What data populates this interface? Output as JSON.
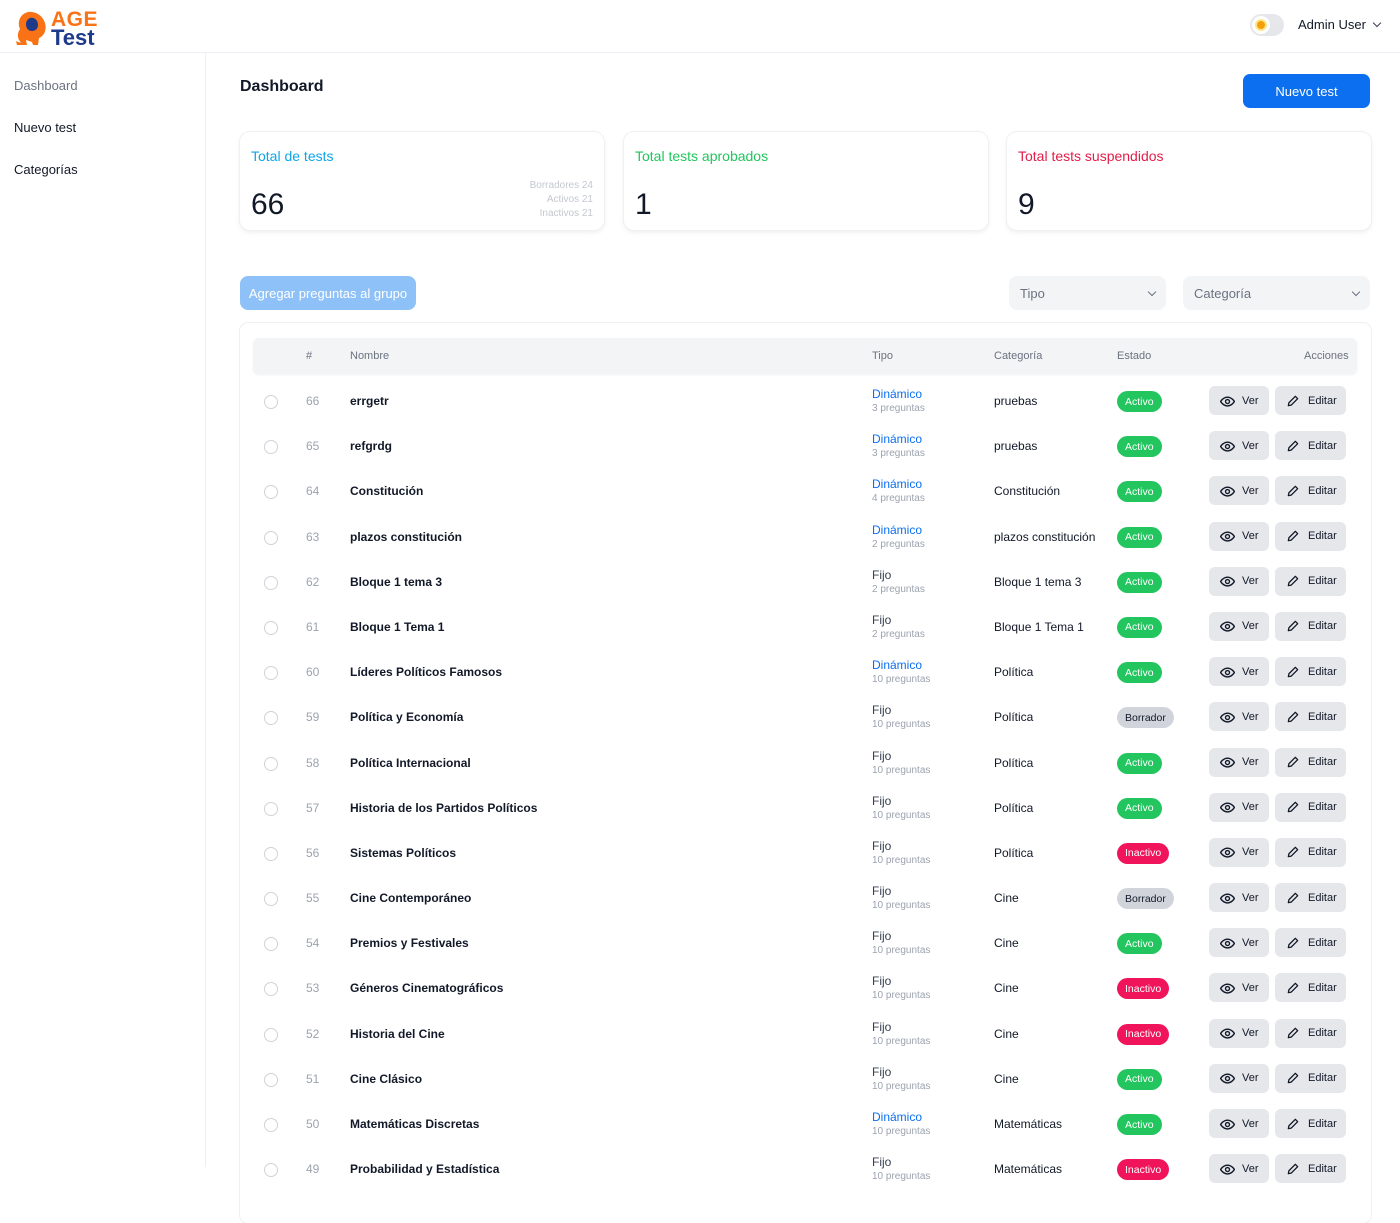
{
  "app": {
    "logo_top": "AGE",
    "logo_bottom": "Test",
    "user_name": "Admin User"
  },
  "sidebar": {
    "items": [
      {
        "label": "Dashboard"
      },
      {
        "label": "Nuevo test"
      },
      {
        "label": "Categorías"
      }
    ]
  },
  "header": {
    "title": "Dashboard",
    "new_test_label": "Nuevo test"
  },
  "stats": {
    "total": {
      "title": "Total de tests",
      "value": "66",
      "borradores": "Borradores 24",
      "activos": "Activos 21",
      "inactivos": "Inactivos 21",
      "color": "#0ea5e9"
    },
    "aprobados": {
      "title": "Total tests aprobados",
      "value": "1",
      "color": "#22c55e"
    },
    "suspendidos": {
      "title": "Total tests suspendidos",
      "value": "9",
      "color": "#e11d48"
    }
  },
  "filters": {
    "group_button": "Agregar preguntas al grupo",
    "tipo_placeholder": "Tipo",
    "categoria_placeholder": "Categoría"
  },
  "table": {
    "headers": {
      "id": "#",
      "nombre": "Nombre",
      "tipo": "Tipo",
      "categoria": "Categoría",
      "estado": "Estado",
      "acciones": "Acciones"
    },
    "ver_label": "Ver",
    "editar_label": "Editar",
    "rows": [
      {
        "id": "66",
        "nombre": "errgetr",
        "tipo": "Dinámico",
        "preguntas": "3 preguntas",
        "categoria": "pruebas",
        "estado": "Activo"
      },
      {
        "id": "65",
        "nombre": "refgrdg",
        "tipo": "Dinámico",
        "preguntas": "3 preguntas",
        "categoria": "pruebas",
        "estado": "Activo"
      },
      {
        "id": "64",
        "nombre": "Constitución",
        "tipo": "Dinámico",
        "preguntas": "4 preguntas",
        "categoria": "Constitución",
        "estado": "Activo"
      },
      {
        "id": "63",
        "nombre": "plazos constitución",
        "tipo": "Dinámico",
        "preguntas": "2 preguntas",
        "categoria": "plazos constitución",
        "estado": "Activo"
      },
      {
        "id": "62",
        "nombre": "Bloque 1 tema 3",
        "tipo": "Fijo",
        "preguntas": "2 preguntas",
        "categoria": "Bloque 1 tema 3",
        "estado": "Activo"
      },
      {
        "id": "61",
        "nombre": "Bloque 1 Tema 1",
        "tipo": "Fijo",
        "preguntas": "2 preguntas",
        "categoria": "Bloque 1 Tema 1",
        "estado": "Activo"
      },
      {
        "id": "60",
        "nombre": "Líderes Políticos Famosos",
        "tipo": "Dinámico",
        "preguntas": "10 preguntas",
        "categoria": "Política",
        "estado": "Activo"
      },
      {
        "id": "59",
        "nombre": "Política y Economía",
        "tipo": "Fijo",
        "preguntas": "10 preguntas",
        "categoria": "Política",
        "estado": "Borrador"
      },
      {
        "id": "58",
        "nombre": "Política Internacional",
        "tipo": "Fijo",
        "preguntas": "10 preguntas",
        "categoria": "Política",
        "estado": "Activo"
      },
      {
        "id": "57",
        "nombre": "Historia de los Partidos Políticos",
        "tipo": "Fijo",
        "preguntas": "10 preguntas",
        "categoria": "Política",
        "estado": "Activo"
      },
      {
        "id": "56",
        "nombre": "Sistemas Políticos",
        "tipo": "Fijo",
        "preguntas": "10 preguntas",
        "categoria": "Política",
        "estado": "Inactivo"
      },
      {
        "id": "55",
        "nombre": "Cine Contemporáneo",
        "tipo": "Fijo",
        "preguntas": "10 preguntas",
        "categoria": "Cine",
        "estado": "Borrador"
      },
      {
        "id": "54",
        "nombre": "Premios y Festivales",
        "tipo": "Fijo",
        "preguntas": "10 preguntas",
        "categoria": "Cine",
        "estado": "Activo"
      },
      {
        "id": "53",
        "nombre": "Géneros Cinematográficos",
        "tipo": "Fijo",
        "preguntas": "10 preguntas",
        "categoria": "Cine",
        "estado": "Inactivo"
      },
      {
        "id": "52",
        "nombre": "Historia del Cine",
        "tipo": "Fijo",
        "preguntas": "10 preguntas",
        "categoria": "Cine",
        "estado": "Inactivo"
      },
      {
        "id": "51",
        "nombre": "Cine Clásico",
        "tipo": "Fijo",
        "preguntas": "10 preguntas",
        "categoria": "Cine",
        "estado": "Activo"
      },
      {
        "id": "50",
        "nombre": "Matemáticas Discretas",
        "tipo": "Dinámico",
        "preguntas": "10 preguntas",
        "categoria": "Matemáticas",
        "estado": "Activo"
      },
      {
        "id": "49",
        "nombre": "Probabilidad y Estadística",
        "tipo": "Fijo",
        "preguntas": "10 preguntas",
        "categoria": "Matemáticas",
        "estado": "Inactivo"
      }
    ]
  },
  "colors": {
    "primary": "#0b6ff0",
    "activo": "#22c55e",
    "inactivo": "#f0145a",
    "borrador": "#d1d5db"
  }
}
